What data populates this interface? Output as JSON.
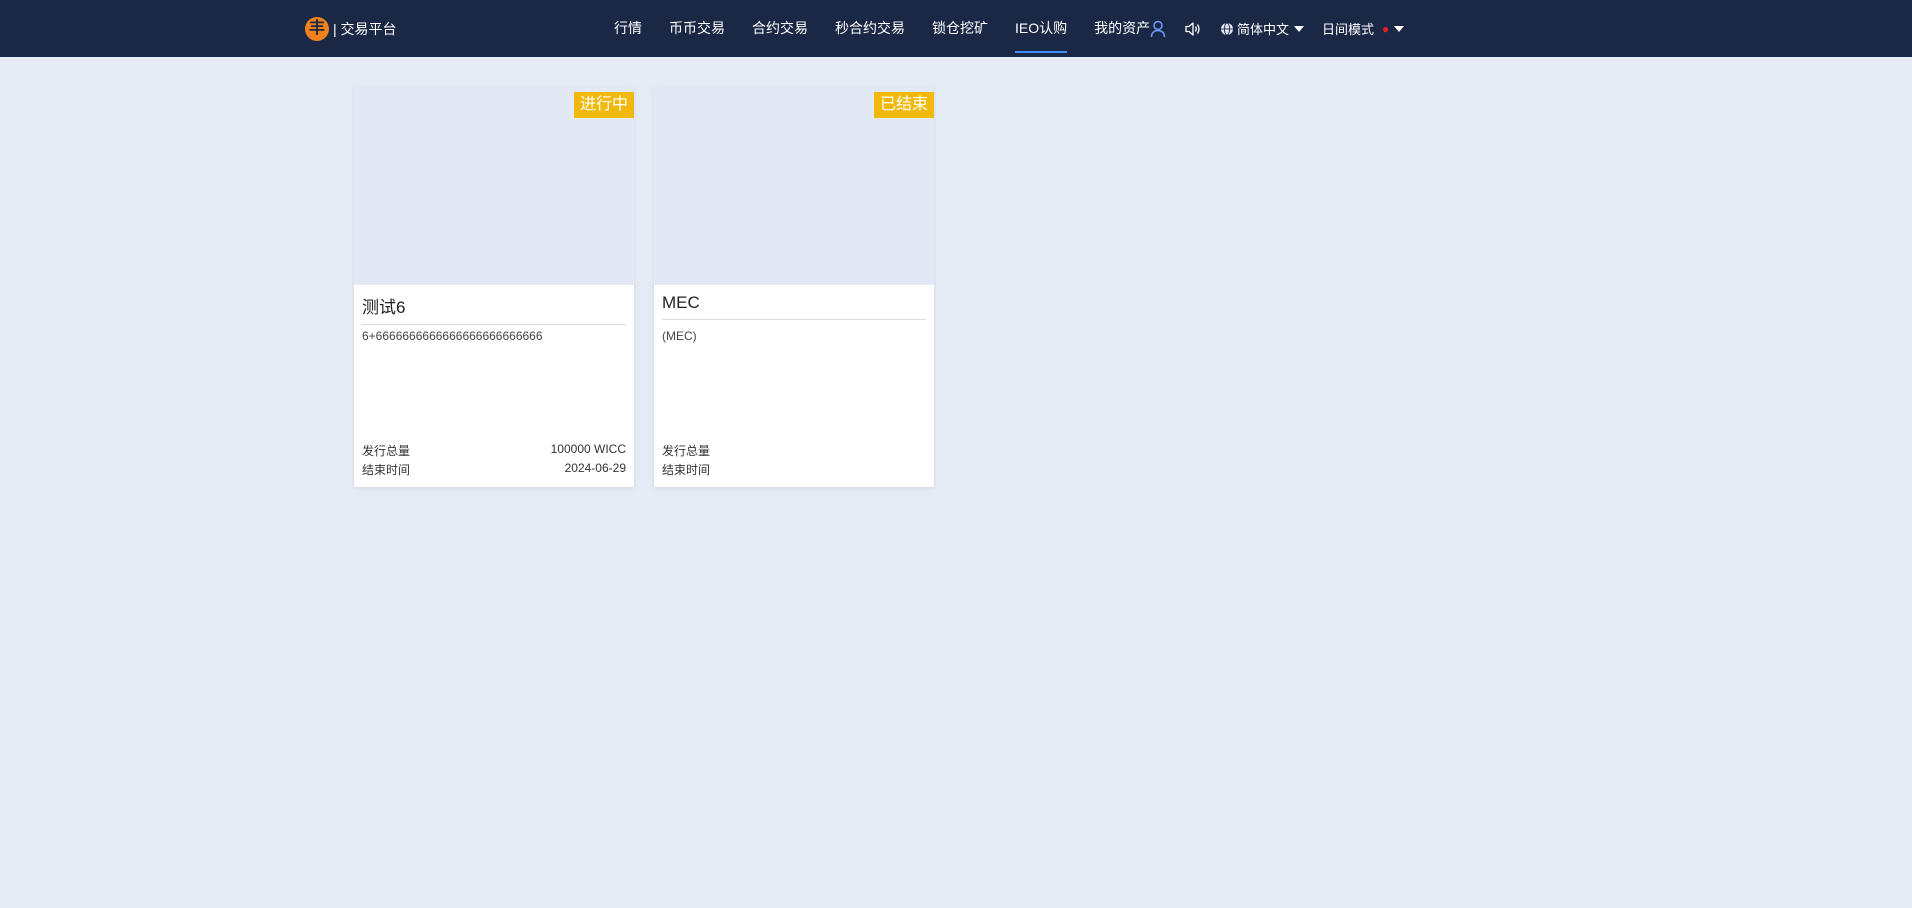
{
  "header": {
    "logo_glyph": "丰",
    "brand": "| 交易平台",
    "nav": [
      {
        "label": "行情"
      },
      {
        "label": "币币交易"
      },
      {
        "label": "合约交易"
      },
      {
        "label": "秒合约交易"
      },
      {
        "label": "锁仓挖矿"
      },
      {
        "label": "IEO认购",
        "active": true
      },
      {
        "label": "我的资产"
      }
    ],
    "icons": [
      "user-icon",
      "speaker-icon",
      "globe-icon"
    ],
    "language": "简体中文",
    "mode": "日间模式",
    "accent_color": "#3f8cff",
    "bg_color": "#1b2845"
  },
  "cards": [
    {
      "badge": "进行中",
      "title": "测试6",
      "desc": "6+6666666666666666666666666",
      "total_label": "发行总量",
      "total_value": "100000 WICC",
      "end_label": "结束时间",
      "end_value": "2024-06-29"
    },
    {
      "badge": "已结束",
      "title": "MEC",
      "desc": "(MEC)",
      "total_label": "发行总量",
      "total_value": "",
      "end_label": "结束时间",
      "end_value": ""
    }
  ],
  "colors": {
    "badge": "#f0b90b",
    "page_bg": "#e4ebf5"
  }
}
